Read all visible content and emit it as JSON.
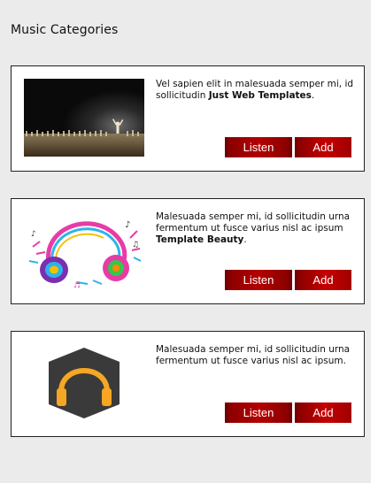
{
  "page": {
    "title": "Music Categories"
  },
  "categories": [
    {
      "text": "Vel sapien elit in malesuada semper mi, id sollicitudin ",
      "bold": "Just Web Templates",
      "after": ".",
      "image_icon": "concert-crowd-image",
      "listen_label": "Listen",
      "add_label": "Add"
    },
    {
      "text": "Malesuada semper mi, id sollicitudin urna fermentum ut fusce varius nisl ac ipsum ",
      "bold": "Template Beauty",
      "after": ".",
      "image_icon": "colorful-headphones-image",
      "listen_label": "Listen",
      "add_label": "Add"
    },
    {
      "text": "Malesuada semper mi, id sollicitudin urna fermentum ut fusce varius nisl ac ipsum.",
      "bold": "",
      "after": "",
      "image_icon": "headphones-hexagon-icon",
      "listen_label": "Listen",
      "add_label": "Add"
    }
  ],
  "colors": {
    "button_red": "#b40000",
    "panel_bg": "#ebebeb",
    "icon_hex": "#3a3a3a",
    "icon_headphones": "#f5a623"
  }
}
